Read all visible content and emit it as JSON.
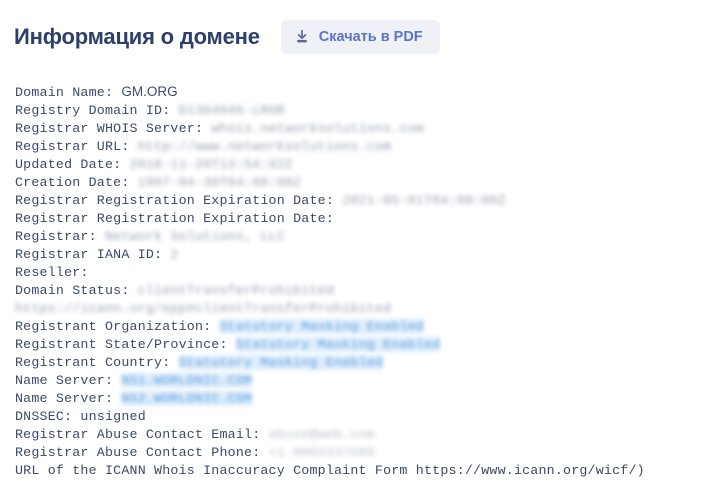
{
  "header": {
    "title": "Информация о домене",
    "download_button": {
      "label": "Скачать в PDF",
      "icon": "download-icon"
    }
  },
  "colors": {
    "title": "#2e3f6b",
    "button_bg": "#eff1f6",
    "button_text": "#5b74c4",
    "body_text": "#3c4a66",
    "highlight_bg": "#d7eafc",
    "highlight_text": "#2f7fd1",
    "page_bg": "#ffffff"
  },
  "whois": {
    "records": [
      {
        "label": "Domain Name: ",
        "value": "GM.ORG",
        "style": "plain"
      },
      {
        "label": "Registry Domain ID: ",
        "value": "D1364046-LROR",
        "style": "blurred"
      },
      {
        "label": "Registrar WHOIS Server: ",
        "value": "whois.networksolutions.com",
        "style": "blurred"
      },
      {
        "label": "Registrar URL: ",
        "value": "http://www.networksolutions.com",
        "style": "blurred"
      },
      {
        "label": "Updated Date: ",
        "value": "2018-11-20T13:54:02Z",
        "style": "blurred"
      },
      {
        "label": "Creation Date: ",
        "value": "1997-04-30T04:00:00Z",
        "style": "blurred"
      },
      {
        "label": "Registrar Registration Expiration Date: ",
        "value": "2021-05-01T04:00:00Z",
        "style": "blurred"
      },
      {
        "label": "Registrar Registration Expiration Date: ",
        "value": "",
        "style": "blurred"
      },
      {
        "label": "Registrar: ",
        "value": "Network Solutions, LLC",
        "style": "blurred"
      },
      {
        "label": "Registrar IANA ID: ",
        "value": "2",
        "style": "blurred"
      },
      {
        "label": "Reseller: ",
        "value": "",
        "style": "blurred"
      },
      {
        "label": "Domain Status: ",
        "value": "clientTransferProhibited https://icann.org/epp#clientTransferProhibited",
        "style": "blurred"
      },
      {
        "label": "Registrant Organization: ",
        "value": "Statutory Masking Enabled",
        "style": "highlighted"
      },
      {
        "label": "Registrant State/Province: ",
        "value": "Statutory Masking Enabled",
        "style": "highlighted"
      },
      {
        "label": "Registrant Country: ",
        "value": "Statutory Masking Enabled",
        "style": "highlighted"
      },
      {
        "label": "Name Server: ",
        "value": "NS1.WORLDNIC.COM",
        "style": "highlighted"
      },
      {
        "label": "Name Server: ",
        "value": "NS2.WORLDNIC.COM",
        "style": "highlighted"
      },
      {
        "label": "DNSSEC: unsigned",
        "value": "",
        "style": "plainlabel"
      },
      {
        "label": "Registrar Abuse Contact Email: ",
        "value": "abuse@web.com",
        "style": "gray"
      },
      {
        "label": "Registrar Abuse Contact Phone: ",
        "value": "+1.8003337680",
        "style": "gray"
      },
      {
        "label": "URL of the ICANN Whois Inaccuracy Complaint Form https://www.icann.org/wicf/)",
        "value": "",
        "style": "plainlabel"
      }
    ]
  }
}
